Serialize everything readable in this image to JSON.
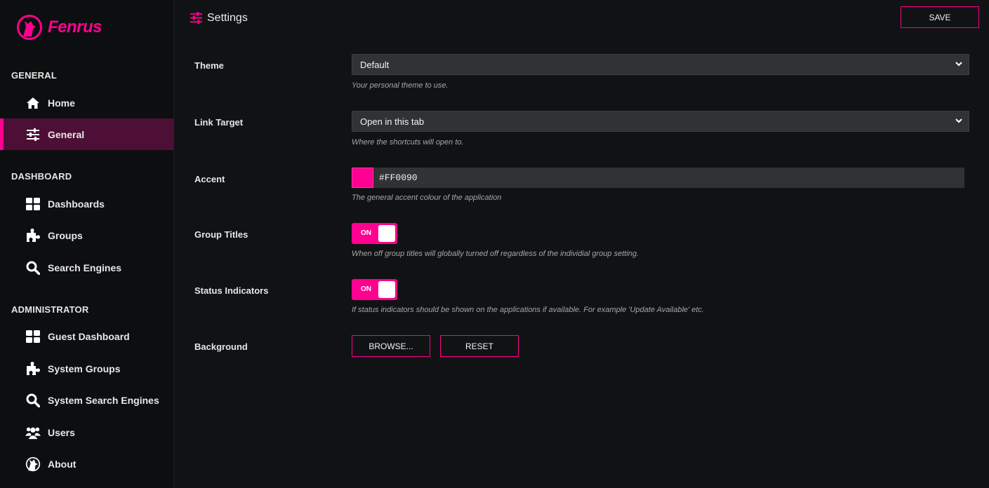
{
  "app": {
    "name": "Fenrus",
    "accent": "#ff0090"
  },
  "sidebar": {
    "sections": [
      {
        "title": "GENERAL"
      },
      {
        "title": "DASHBOARD"
      },
      {
        "title": "ADMINISTRATOR"
      }
    ],
    "items": [
      {
        "label": "Home",
        "icon": "home-icon"
      },
      {
        "label": "General",
        "icon": "sliders-icon",
        "active": true
      },
      {
        "label": "Dashboards",
        "icon": "grid-icon"
      },
      {
        "label": "Groups",
        "icon": "puzzle-icon"
      },
      {
        "label": "Search Engines",
        "icon": "search-icon"
      },
      {
        "label": "Guest Dashboard",
        "icon": "grid-icon"
      },
      {
        "label": "System Groups",
        "icon": "puzzle-icon"
      },
      {
        "label": "System Search Engines",
        "icon": "search-icon"
      },
      {
        "label": "Users",
        "icon": "users-icon"
      },
      {
        "label": "About",
        "icon": "fenrus-logo-icon"
      }
    ]
  },
  "header": {
    "title": "Settings",
    "save_label": "SAVE"
  },
  "settings": {
    "theme": {
      "label": "Theme",
      "value": "Default",
      "help": "Your personal theme to use."
    },
    "link_target": {
      "label": "Link Target",
      "value": "Open in this tab",
      "help": "Where the shortcuts will open to."
    },
    "accent": {
      "label": "Accent",
      "value": "#FF0090",
      "help": "The general accent colour of the application"
    },
    "group_titles": {
      "label": "Group Titles",
      "state": "ON",
      "help": "When off group titles will globally turned off regardless of the individial group setting."
    },
    "status_indicators": {
      "label": "Status Indicators",
      "state": "ON",
      "help": "If status indicators should be shown on the applications if available.  For example 'Update Available' etc."
    },
    "background": {
      "label": "Background",
      "browse_label": "BROWSE...",
      "reset_label": "RESET"
    }
  }
}
